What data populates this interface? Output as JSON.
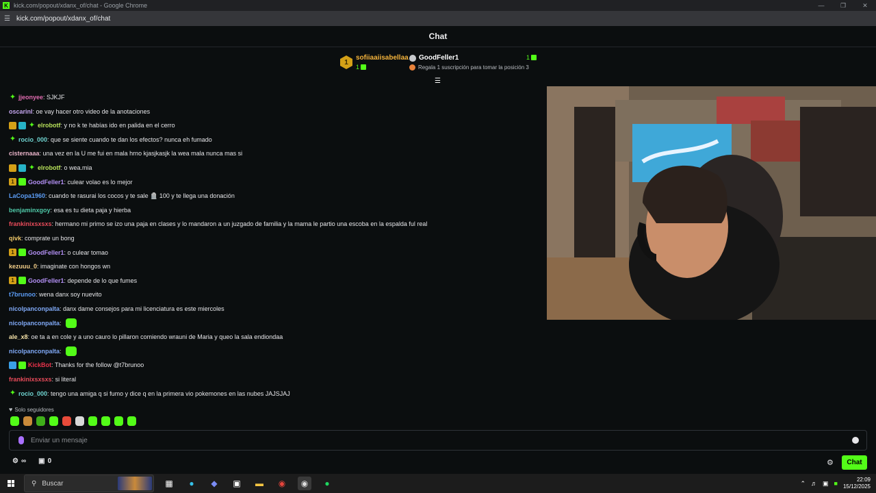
{
  "window": {
    "title": "kick.com/popout/xdanx_of/chat - Google Chrome",
    "url": "kick.com/popout/xdanx_of/chat",
    "logo_letter": "K"
  },
  "header": {
    "title": "Chat"
  },
  "leaderboard": {
    "first": {
      "rank": "1",
      "name": "sofiiaaiisabellaa",
      "count": "1"
    },
    "second": {
      "name": "GoodFeller1",
      "count": "1",
      "hint": "Regala 1 suscripción para tomar la posición 3"
    }
  },
  "messages": [
    {
      "badges": [
        "star"
      ],
      "user": "jjeonyee",
      "color": "#e06cb0",
      "text": "SJKJF"
    },
    {
      "badges": [],
      "user": "oscarinl",
      "color": "#c6a7f0",
      "text": "oe vay hacer otro video de la anotaciones"
    },
    {
      "badges": [
        "crown",
        "blue",
        "star"
      ],
      "user": "elrobotf",
      "color": "#b8e25a",
      "text": "y no k te habías ido en palida en el cerro"
    },
    {
      "badges": [
        "star"
      ],
      "user": "rocio_000",
      "color": "#6fd3d0",
      "text": "que se siente cuando te dan los efectos? nunca eh fumado"
    },
    {
      "badges": [],
      "user": "cisternaaa",
      "color": "#e8b3c8",
      "text": "una vez en la U me fui en mala hrno kjasjkasjk la wea mala nunca mas si"
    },
    {
      "badges": [
        "crown",
        "blue",
        "star"
      ],
      "user": "elrobotf",
      "color": "#b8e25a",
      "text": "o wea.mia"
    },
    {
      "badges": [
        "gold",
        "gift"
      ],
      "user": "GoodFeller1",
      "color": "#b390f5",
      "text": "culear volao es lo mejor"
    },
    {
      "badges": [],
      "user": "LaCopa1960",
      "color": "#5b9cf5",
      "text": "cuando te rasurai los cocos y te sale 🪦 100 y te llega una donación"
    },
    {
      "badges": [],
      "user": "benjaminxgoy",
      "color": "#4fc9a8",
      "text": "esa es tu dieta paja y hierba"
    },
    {
      "badges": [],
      "user": "frankinixsxsxs",
      "color": "#e84b5a",
      "text": "hermano mi primo se izo una paja en clases y lo mandaron a un juzgado de familia y la mama le partio una escoba en la espalda ful real"
    },
    {
      "badges": [],
      "user": "qivk",
      "color": "#f0c86a",
      "text": "comprate un bong"
    },
    {
      "badges": [
        "gold",
        "gift"
      ],
      "user": "GoodFeller1",
      "color": "#b390f5",
      "text": "o culear tomao"
    },
    {
      "badges": [],
      "user": "kezuuu_0",
      "color": "#f5d08a",
      "text": "imaginate con hongos wn"
    },
    {
      "badges": [
        "gold",
        "gift"
      ],
      "user": "GoodFeller1",
      "color": "#b390f5",
      "text": "depende de lo que fumes"
    },
    {
      "badges": [],
      "user": "t7brunoo",
      "color": "#5b9cf5",
      "text": "wena danx soy nuevito"
    },
    {
      "badges": [],
      "user": "nicolpanconpalta",
      "color": "#7fa8f5",
      "text": "danx dame consejos para mi licenciatura es este miercoles"
    },
    {
      "badges": [],
      "user": "nicolpanconpalta",
      "color": "#7fa8f5",
      "text": "",
      "emote": true
    },
    {
      "badges": [],
      "user": "ale_x8",
      "color": "#f5e2a8",
      "text": "oe ta a en cole y a uno cauro lo pillaron comiendo wrauni de Maria y queo la sala endiondaa"
    },
    {
      "badges": [],
      "user": "nicolpanconpalta",
      "color": "#7fa8f5",
      "text": "",
      "emote": true
    },
    {
      "badges": [
        "bot",
        "verified"
      ],
      "user": "KickBot",
      "color": "#e8324a",
      "text": "Thanks for the follow @t7brunoo"
    },
    {
      "badges": [],
      "user": "frankinixsxsxs",
      "color": "#e84b5a",
      "text": "si literal"
    },
    {
      "badges": [
        "star"
      ],
      "user": "rocio_000",
      "color": "#6fd3d0",
      "text": "tengo una amiga q si fumo y dice q en la primera vio pokemones en las nubes JAJSJAJ"
    }
  ],
  "followers_only": "Solo seguidores",
  "input": {
    "placeholder": "Enviar un mensaje"
  },
  "bottom": {
    "infinity": "∞",
    "count": "0",
    "chat_button": "Chat"
  },
  "taskbar": {
    "search": "Buscar",
    "time": "22:09",
    "date": "15/12/2025"
  },
  "colors": {
    "accent": "#53fc18",
    "background": "#0b0e0f"
  }
}
